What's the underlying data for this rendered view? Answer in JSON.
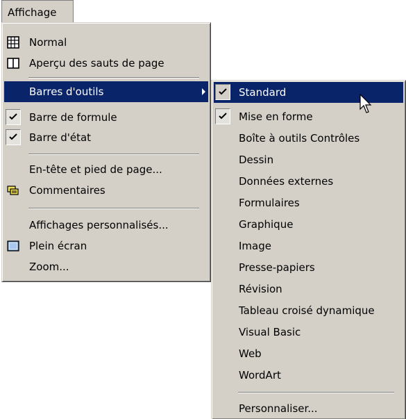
{
  "menubar": {
    "label": "Affichage"
  },
  "main_menu": {
    "items": [
      {
        "label": "Normal",
        "icon": "normal-view-icon"
      },
      {
        "label": "Aperçu des sauts de page",
        "icon": "page-break-preview-icon"
      },
      {
        "label": "Barres d'outils",
        "submenu": true,
        "highlighted": true
      },
      {
        "label": "Barre de formule",
        "checked": true
      },
      {
        "label": "Barre d'état",
        "checked": true
      },
      {
        "label": "En-tête et pied de page..."
      },
      {
        "label": "Commentaires",
        "icon": "comments-icon"
      },
      {
        "label": "Affichages personnalisés..."
      },
      {
        "label": "Plein écran",
        "icon": "full-screen-icon"
      },
      {
        "label": "Zoom..."
      }
    ]
  },
  "toolbars_submenu": {
    "items": [
      {
        "label": "Standard",
        "checked": true,
        "highlighted": true
      },
      {
        "label": "Mise en forme",
        "checked": true
      },
      {
        "label": "Boîte à outils Contrôles"
      },
      {
        "label": "Dessin"
      },
      {
        "label": "Données externes"
      },
      {
        "label": "Formulaires"
      },
      {
        "label": "Graphique"
      },
      {
        "label": "Image"
      },
      {
        "label": "Presse-papiers"
      },
      {
        "label": "Révision"
      },
      {
        "label": "Tableau croisé dynamique"
      },
      {
        "label": "Visual Basic"
      },
      {
        "label": "Web"
      },
      {
        "label": "WordArt"
      },
      {
        "label": "Personnaliser..."
      }
    ]
  },
  "colors": {
    "menu_bg": "#d4d0c8",
    "highlight": "#0a246a",
    "highlight_text": "#ffffff"
  }
}
